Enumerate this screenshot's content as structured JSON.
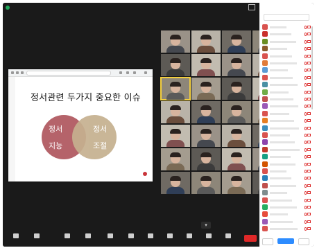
{
  "slide": {
    "title": "정서관련 두가지 중요한 이슈",
    "left_circle": [
      "정서",
      "지능"
    ],
    "right_circle": [
      "정서",
      "조절"
    ]
  },
  "colors": {
    "left_circle": "#b5636a",
    "right_circle": "#c5b08f",
    "end_button": "#e02828",
    "active_speaker": "#f4d03f",
    "shield": "#1fa85a"
  },
  "gallery": {
    "tile_count": 35,
    "active_tile_index": 10
  },
  "controls": {
    "items": [
      {
        "icon": "microphone-icon"
      },
      {
        "icon": "video-camera-icon"
      },
      {
        "icon": "security-shield-icon"
      },
      {
        "icon": "participants-icon"
      },
      {
        "icon": "chat-icon"
      },
      {
        "icon": "share-screen-icon"
      },
      {
        "icon": "record-icon"
      },
      {
        "icon": "reactions-icon"
      },
      {
        "icon": "apps-icon"
      },
      {
        "icon": "whiteboard-icon"
      },
      {
        "icon": "more-icon"
      }
    ]
  },
  "participants_panel": {
    "row_count": 29,
    "avatar_colors": [
      "#d9534f",
      "#c9302c",
      "#6b8e23",
      "#8b5a2b",
      "#d9534f",
      "#e07b39",
      "#5b9bd5",
      "#d9534f",
      "#4a90a4",
      "#70ad47",
      "#c0504d",
      "#9b59b6",
      "#d9534f",
      "#e67e22",
      "#3c8dbc",
      "#d9534f",
      "#8e44ad",
      "#c0392b",
      "#16a085",
      "#d35400",
      "#d9534f",
      "#2980b9",
      "#c0504d",
      "#7f8c8d",
      "#d9534f",
      "#27ae60",
      "#e74c3c",
      "#9b59b6",
      "#d9534f"
    ]
  }
}
